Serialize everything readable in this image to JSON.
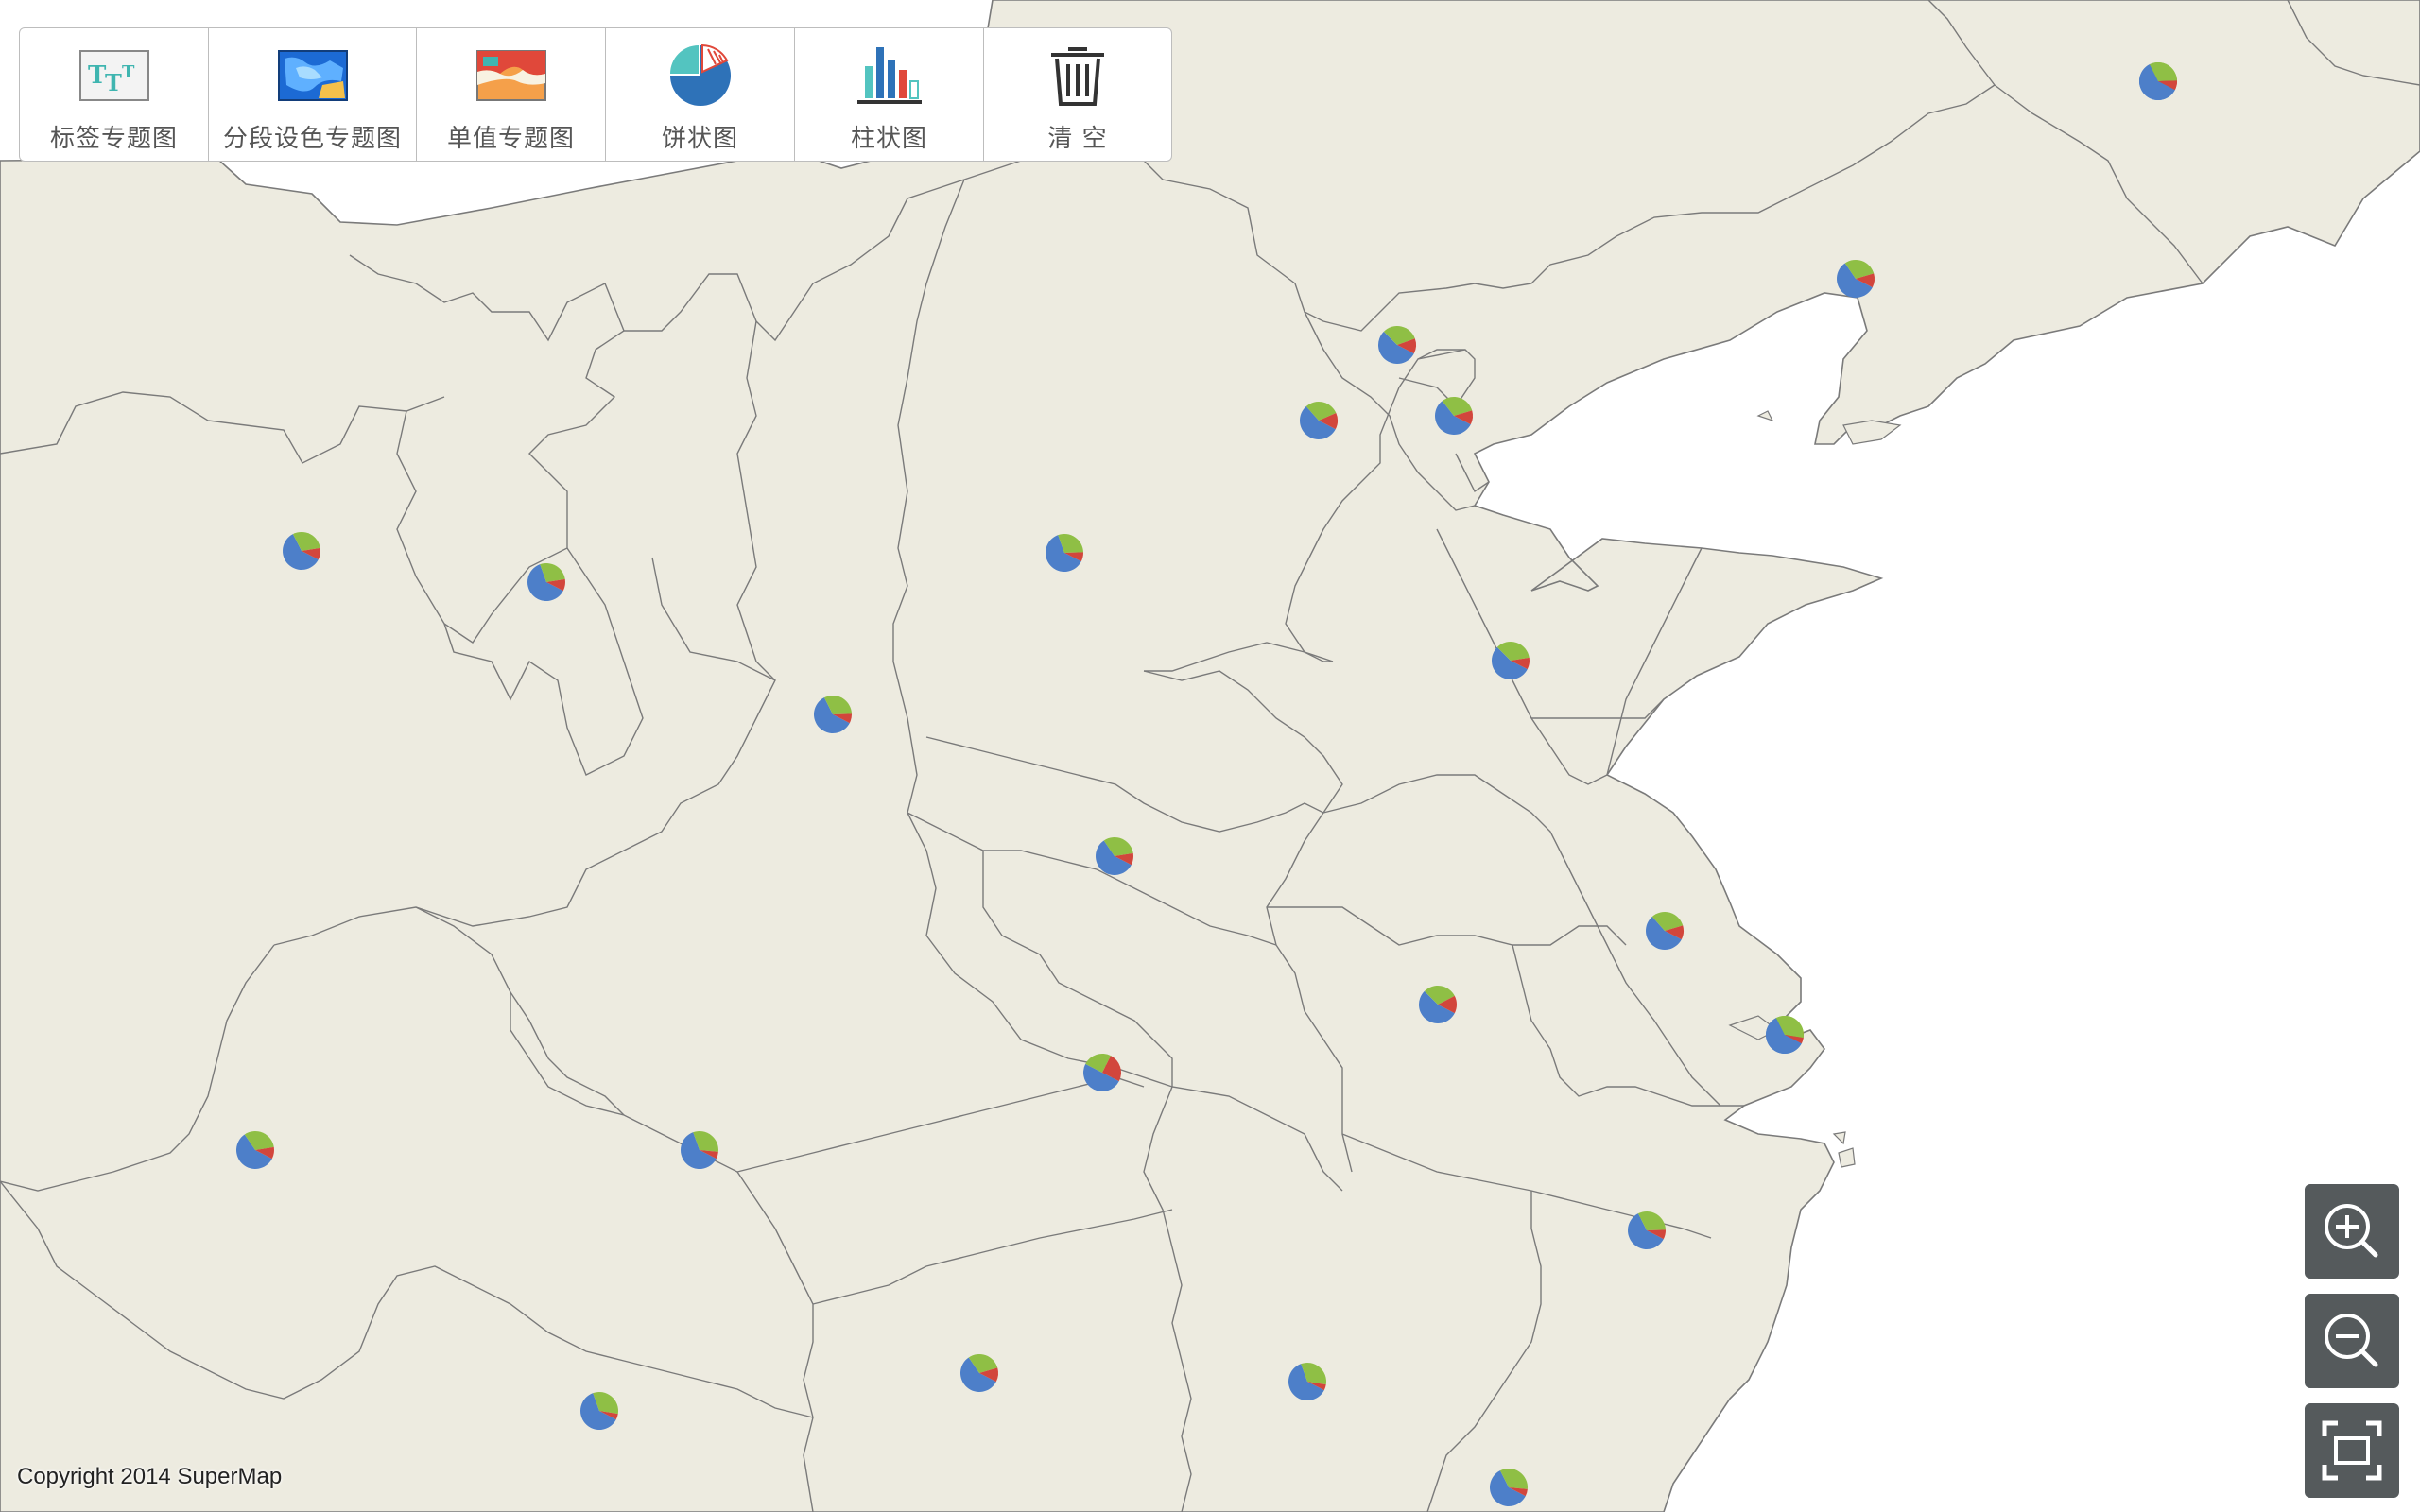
{
  "toolbar": {
    "items": [
      {
        "label": "标签专题图",
        "icon": "label-thematic-icon"
      },
      {
        "label": "分段设色专题图",
        "icon": "range-thematic-icon"
      },
      {
        "label": "单值专题图",
        "icon": "unique-thematic-icon"
      },
      {
        "label": "饼状图",
        "icon": "pie-chart-icon"
      },
      {
        "label": "柱状图",
        "icon": "bar-chart-icon"
      },
      {
        "label": "清 空",
        "icon": "trash-icon"
      }
    ]
  },
  "zoom": {
    "in_icon": "zoom-in-icon",
    "out_icon": "zoom-out-icon",
    "full_icon": "full-extent-icon"
  },
  "copyright": "Copyright 2014 SuperMap",
  "colors": {
    "land": "#edebe0",
    "sea": "#ffffff",
    "border": "#7a7a7a",
    "pie_blue": "#4d7fc9",
    "pie_green": "#8fbf45",
    "pie_red": "#d2463c",
    "button": "#555a5c"
  },
  "pie_charts": [
    {
      "values": [
        62,
        28,
        10
      ]
    },
    {
      "values": [
        58,
        30,
        12
      ]
    },
    {
      "values": [
        55,
        32,
        13
      ]
    },
    {
      "values": [
        56,
        30,
        14
      ]
    },
    {
      "values": [
        57,
        31,
        12
      ]
    },
    {
      "values": [
        60,
        30,
        10
      ]
    },
    {
      "values": [
        62,
        28,
        10
      ]
    },
    {
      "values": [
        62,
        30,
        8
      ]
    },
    {
      "values": [
        60,
        32,
        8
      ]
    },
    {
      "values": [
        55,
        35,
        10
      ]
    },
    {
      "values": [
        58,
        32,
        10
      ]
    },
    {
      "values": [
        56,
        32,
        12
      ]
    },
    {
      "values": [
        55,
        30,
        15
      ]
    },
    {
      "values": [
        58,
        32,
        10
      ]
    },
    {
      "values": [
        50,
        25,
        25
      ]
    },
    {
      "values": [
        58,
        32,
        10
      ]
    },
    {
      "values": [
        62,
        32,
        6
      ]
    },
    {
      "values": [
        60,
        32,
        8
      ]
    },
    {
      "values": [
        58,
        30,
        12
      ]
    },
    {
      "values": [
        62,
        33,
        5
      ]
    },
    {
      "values": [
        62,
        33,
        5
      ]
    },
    {
      "values": [
        60,
        34,
        6
      ]
    },
    {
      "values": [
        60,
        35,
        5
      ]
    },
    {
      "values": [
        60,
        32,
        8
      ]
    }
  ]
}
